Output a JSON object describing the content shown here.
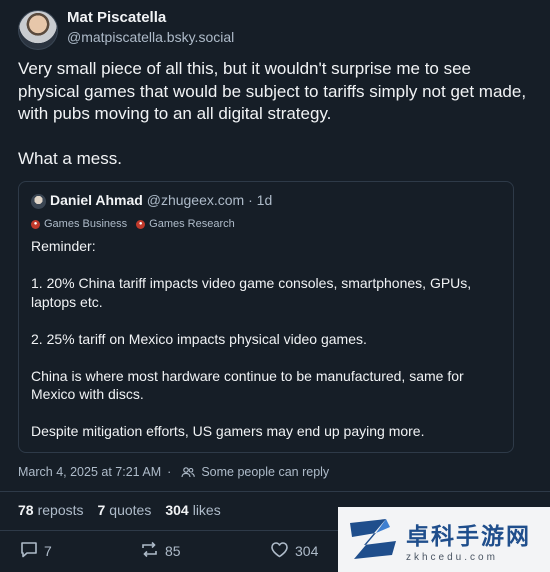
{
  "author": {
    "name": "Mat Piscatella",
    "handle": "@matpiscatella.bsky.social"
  },
  "post": {
    "paragraphs": [
      "Very small piece of all this, but it wouldn't surprise me to see physical games that would be subject to tariffs simply not get made, with pubs moving to an all digital strategy.",
      "What a mess."
    ],
    "timestamp": "March 4, 2025 at 7:21 AM",
    "separator": "·",
    "reply_setting": "Some people can reply"
  },
  "quote": {
    "name": "Daniel Ahmad",
    "handle": "@zhugeex.com",
    "age": "· 1d",
    "tags": [
      "Games Business",
      "Games Research"
    ],
    "paragraphs": [
      "Reminder:",
      "1. 20% China tariff impacts video game consoles, smartphones, GPUs, laptops etc.",
      "2. 25% tariff on Mexico impacts physical video games.",
      "China is where most hardware continue to be manufactured, same for Mexico with discs.",
      "Despite mitigation efforts, US gamers may end up paying more."
    ]
  },
  "stats": {
    "reposts_count": "78",
    "reposts_label": "reposts",
    "quotes_count": "7",
    "quotes_label": "quotes",
    "likes_count": "304",
    "likes_label": "likes"
  },
  "actions": {
    "replies": "7",
    "reposts": "85",
    "likes": "304"
  },
  "watermark": {
    "title": "卓科手游网",
    "url": "zkhcedu.com"
  },
  "colors": {
    "background": "#161e27",
    "text": "#f1f3f5",
    "muted": "#aebbc9",
    "border": "#2e3a48",
    "tag": "#c0392b"
  }
}
